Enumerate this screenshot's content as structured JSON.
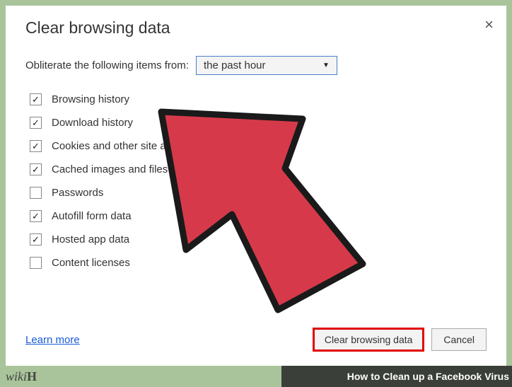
{
  "dialog": {
    "title": "Clear browsing data",
    "prompt": "Obliterate the following items from:",
    "time_range": "the past hour",
    "options": [
      {
        "label": "Browsing history",
        "checked": true
      },
      {
        "label": "Download history",
        "checked": true
      },
      {
        "label": "Cookies and other site and plug-in data",
        "checked": true
      },
      {
        "label": "Cached images and files",
        "checked": true
      },
      {
        "label": "Passwords",
        "checked": false
      },
      {
        "label": "Autofill form data",
        "checked": true
      },
      {
        "label": "Hosted app data",
        "checked": true
      },
      {
        "label": "Content licenses",
        "checked": false
      }
    ],
    "learn_more": "Learn more",
    "primary_button": "Clear browsing data",
    "cancel_button": "Cancel",
    "close_glyph": "×"
  },
  "overlay": {
    "logo": "wiki",
    "logo_suffix": "H",
    "caption": "How to Clean up a Facebook Virus"
  },
  "checkmark_glyph": "✓",
  "caret_glyph": "▼"
}
